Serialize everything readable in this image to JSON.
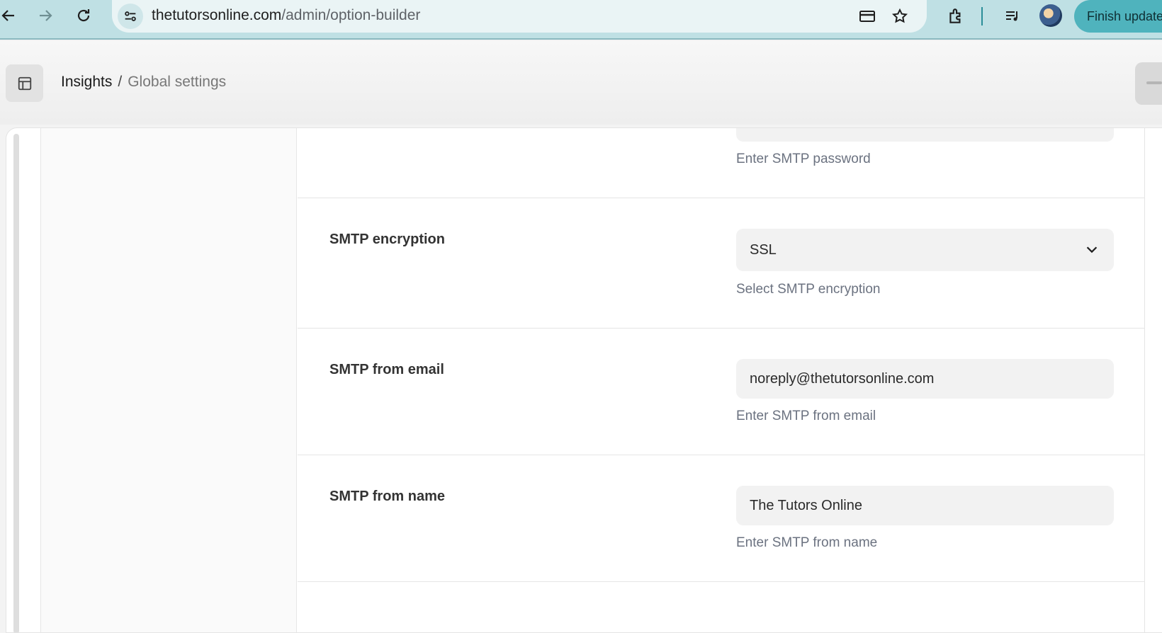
{
  "browser": {
    "url_domain": "thetutorsonline.com",
    "url_path": "/admin/option-builder",
    "finish_update_label": "Finish update"
  },
  "breadcrumb": {
    "first": "Insights",
    "separator": "/",
    "current": "Global settings"
  },
  "settings": {
    "smtp_password": {
      "hint": "Enter SMTP password"
    },
    "smtp_encryption": {
      "label": "SMTP encryption",
      "value": "SSL",
      "hint": "Select SMTP encryption"
    },
    "smtp_from_email": {
      "label": "SMTP from email",
      "value": "noreply@thetutorsonline.com",
      "hint": "Enter SMTP from email"
    },
    "smtp_from_name": {
      "label": "SMTP from name",
      "value": "The Tutors Online",
      "hint": "Enter SMTP from name"
    }
  },
  "colors": {
    "browser_bar": "#bfe0e4",
    "update_button": "#4fb3bd",
    "hint_text": "#6b7280"
  }
}
